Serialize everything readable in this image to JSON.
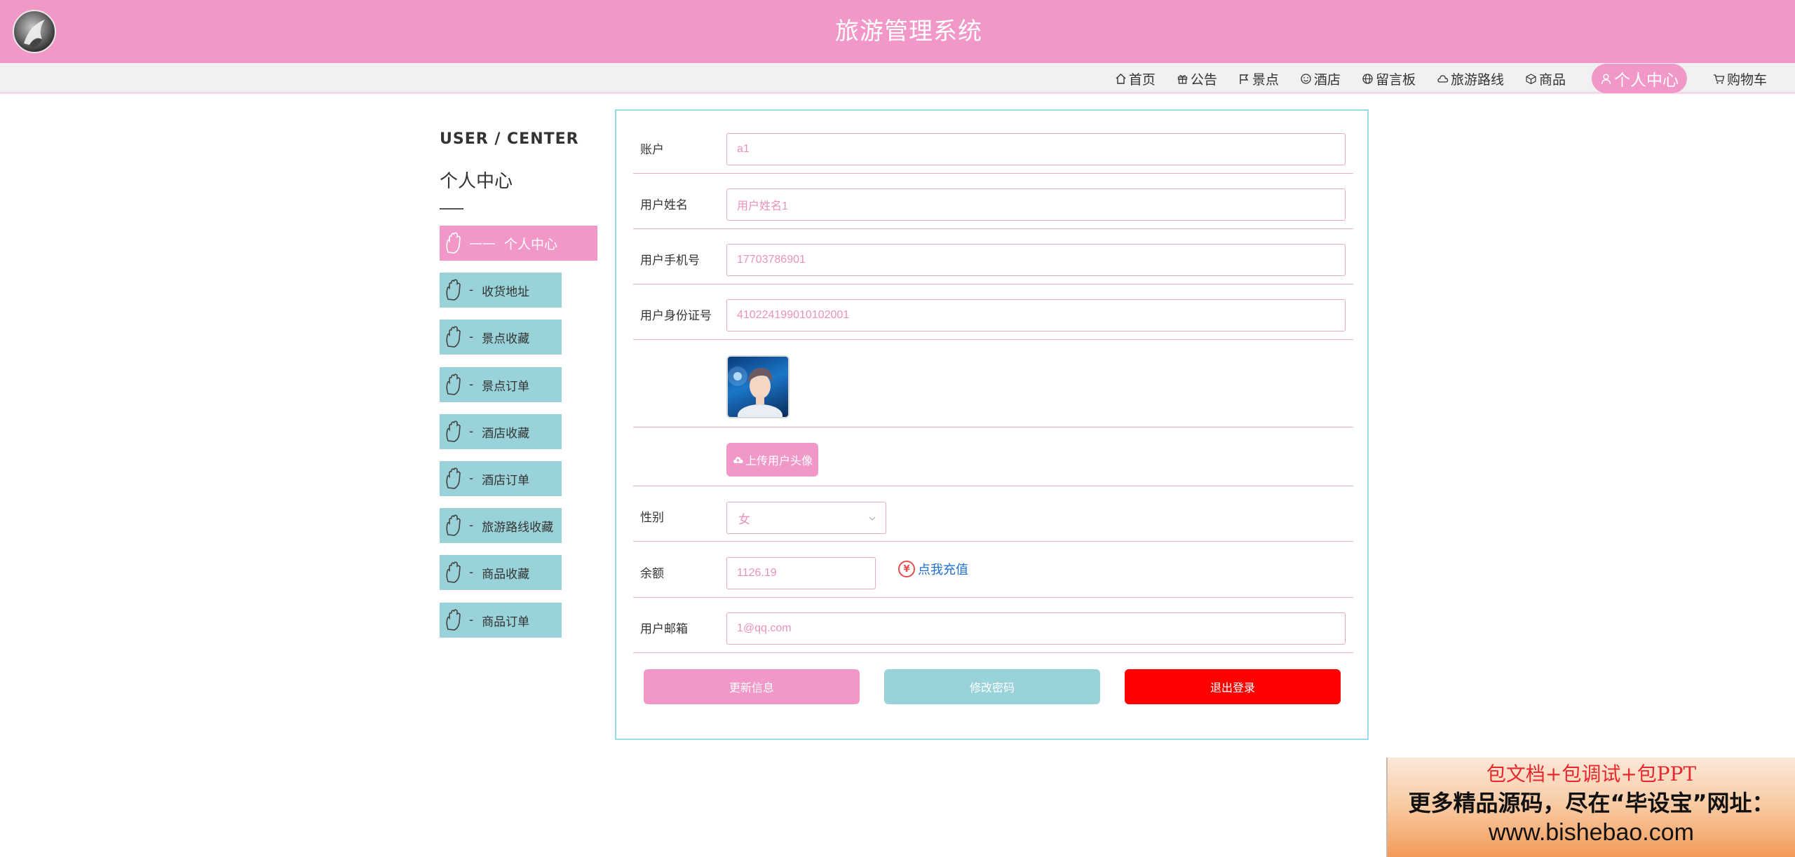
{
  "header": {
    "title": "旅游管理系统"
  },
  "nav": {
    "items": [
      {
        "label": "首页",
        "icon": "home-icon"
      },
      {
        "label": "公告",
        "icon": "gift-icon"
      },
      {
        "label": "景点",
        "icon": "flag-icon"
      },
      {
        "label": "酒店",
        "icon": "smile-icon"
      },
      {
        "label": "留言板",
        "icon": "globe-icon"
      },
      {
        "label": "旅游路线",
        "icon": "cloud-icon"
      },
      {
        "label": "商品",
        "icon": "cube-icon"
      },
      {
        "label": "个人中心",
        "icon": "user-icon",
        "active": true
      },
      {
        "label": "购物车",
        "icon": "cart-icon"
      }
    ]
  },
  "sidebar": {
    "title_en": "USER / CENTER",
    "title_cn": "个人中心",
    "items": [
      {
        "label": "个人中心",
        "prefix": "——",
        "active": true
      },
      {
        "label": "收货地址",
        "prefix": "-"
      },
      {
        "label": "景点收藏",
        "prefix": "-"
      },
      {
        "label": "景点订单",
        "prefix": "-"
      },
      {
        "label": "酒店收藏",
        "prefix": "-"
      },
      {
        "label": "酒店订单",
        "prefix": "-"
      },
      {
        "label": "旅游路线收藏",
        "prefix": "-"
      },
      {
        "label": "商品收藏",
        "prefix": "-"
      },
      {
        "label": "商品订单",
        "prefix": "-"
      }
    ]
  },
  "form": {
    "account_label": "账户",
    "account_value": "a1",
    "name_label": "用户姓名",
    "name_value": "用户姓名1",
    "phone_label": "用户手机号",
    "phone_value": "17703786901",
    "idcard_label": "用户身份证号",
    "idcard_value": "410224199010102001",
    "upload_label": "上传用户头像",
    "gender_label": "性别",
    "gender_value": "女",
    "balance_label": "余额",
    "balance_value": "1126.19",
    "recharge_label": "点我充值",
    "email_label": "用户邮箱",
    "email_value": "1@qq.com",
    "update_button": "更新信息",
    "password_button": "修改密码",
    "logout_button": "退出登录"
  },
  "promo": {
    "line1": "包文档+包调试+包PPT",
    "line2": "更多精品源码，尽在“毕设宝”网址：",
    "line3": "www.bishebao.com"
  },
  "colors": {
    "primary_pink": "#f198c8",
    "teal": "#99d2d9",
    "danger_red": "#ff0000",
    "link_blue": "#1e6fd6"
  }
}
